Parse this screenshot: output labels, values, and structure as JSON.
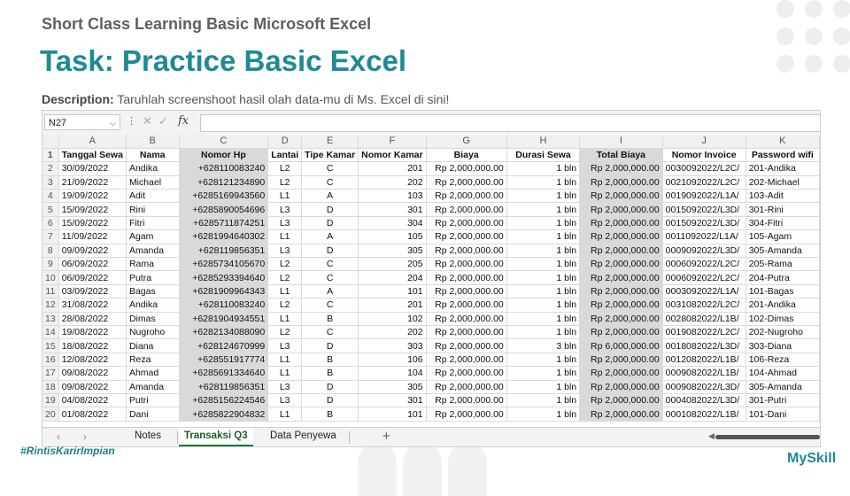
{
  "slide": {
    "subtitle": "Short Class Learning Basic Microsoft Excel",
    "title": "Task: Practice Basic Excel",
    "desc_label": "Description:",
    "desc_text": " Taruhlah screenshoot hasil olah data-mu di Ms. Excel di sini!",
    "hashtag": "#RintisKarirImpian",
    "logo": "MySkill"
  },
  "excel": {
    "name_box": "N27",
    "fx_label": "fx",
    "columns": [
      "A",
      "B",
      "C",
      "D",
      "E",
      "F",
      "G",
      "H",
      "I",
      "J",
      "K"
    ],
    "headers": [
      "Tanggal Sewa",
      "Nama",
      "Nomor Hp",
      "Lantai",
      "Tipe Kamar",
      "Nomor Kamar",
      "Biaya",
      "Durasi Sewa",
      "Total Biaya",
      "Nomor Invoice",
      "Password wifi"
    ],
    "rows": [
      [
        "30/09/2022",
        "Andika",
        "+628110083240",
        "L2",
        "C",
        "201",
        "Rp 2,000,000.00",
        "1 bln",
        "Rp  2,000,000.00",
        "0030092022/L2C/",
        "201-Andika"
      ],
      [
        "21/09/2022",
        "Michael",
        "+62812123489 0",
        "L2",
        "C",
        "202",
        "Rp 2,000,000.00",
        "1 bln",
        "Rp  2,000,000.00",
        "0021092022/L2C/",
        "202-Michael"
      ],
      [
        "19/09/2022",
        "Adit",
        "+6285169943560",
        "L1",
        "A",
        "103",
        "Rp 2,000,000.00",
        "1 bln",
        "Rp  2,000,000.00",
        "0019092022/L1A/",
        "103-Adit"
      ],
      [
        "15/09/2022",
        "Rini",
        "+6285890054696",
        "L3",
        "D",
        "301",
        "Rp 2,000,000.00",
        "1 bln",
        "Rp  2,000,000.00",
        "0015092022/L3D/",
        "301-Rini"
      ],
      [
        "15/09/2022",
        "Fitri",
        "+6285711874251",
        "L3",
        "D",
        "304",
        "Rp 2,000,000.00",
        "1 bln",
        "Rp  2,000,000.00",
        "0015092022/L3D/",
        "304-Fitri"
      ],
      [
        "11/09/2022",
        "Agam",
        "+6281994640302",
        "L1",
        "A",
        "105",
        "Rp 2,000,000.00",
        "1 bln",
        "Rp  2,000,000.00",
        "0011092022/L1A/",
        "105-Agam"
      ],
      [
        "09/09/2022",
        "Amanda",
        "+628119856351",
        "L3",
        "D",
        "305",
        "Rp 2,000,000.00",
        "1 bln",
        "Rp  2,000,000.00",
        "0009092022/L3D/",
        "305-Amanda"
      ],
      [
        "06/09/2022",
        "Rama",
        "+6285734105670",
        "L2",
        "C",
        "205",
        "Rp 2,000,000.00",
        "1 bln",
        "Rp  2,000,000.00",
        "0006092022/L2C/",
        "205-Rama"
      ],
      [
        "06/09/2022",
        "Putra",
        "+6285293394640",
        "L2",
        "C",
        "204",
        "Rp 2,000,000.00",
        "1 bln",
        "Rp  2,000,000.00",
        "0006092022/L2C/",
        "204-Putra"
      ],
      [
        "03/09/2022",
        "Bagas",
        "+6281909964343",
        "L1",
        "A",
        "101",
        "Rp 2,000,000.00",
        "1 bln",
        "Rp  2,000,000.00",
        "0003092022/L1A/",
        "101-Bagas"
      ],
      [
        "31/08/2022",
        "Andika",
        "+628110083240",
        "L2",
        "C",
        "201",
        "Rp 2,000,000.00",
        "1 bln",
        "Rp  2,000,000.00",
        "0031082022/L2C/",
        "201-Andika"
      ],
      [
        "28/08/2022",
        "Dimas",
        "+6281904934551",
        "L1",
        "B",
        "102",
        "Rp 2,000,000.00",
        "1 bln",
        "Rp  2,000,000.00",
        "0028082022/L1B/",
        "102-Dimas"
      ],
      [
        "19/08/2022",
        "Nugroho",
        "+6282134088090",
        "L2",
        "C",
        "202",
        "Rp 2,000,000.00",
        "1 bln",
        "Rp  2,000,000.00",
        "0019082022/L2C/",
        "202-Nugroho"
      ],
      [
        "18/08/2022",
        "Diana",
        "+628124670999",
        "L3",
        "D",
        "303",
        "Rp 2,000,000.00",
        "3 bln",
        "Rp  6,000,000.00",
        "0018082022/L3D/",
        "303-Diana"
      ],
      [
        "12/08/2022",
        "Reza",
        "+628551917774",
        "L1",
        "B",
        "106",
        "Rp 2,000,000.00",
        "1 bln",
        "Rp  2,000,000.00",
        "0012082022/L1B/",
        "106-Reza"
      ],
      [
        "09/08/2022",
        "Ahmad",
        "+6285691334640",
        "L1",
        "B",
        "104",
        "Rp 2,000,000.00",
        "1 bln",
        "Rp  2,000,000.00",
        "0009082022/L1B/",
        "104-Ahmad"
      ],
      [
        "09/08/2022",
        "Amanda",
        "+628119856351",
        "L3",
        "D",
        "305",
        "Rp 2,000,000.00",
        "1 bln",
        "Rp  2,000,000.00",
        "0009082022/L3D/",
        "305-Amanda"
      ],
      [
        "04/08/2022",
        "Putri",
        "+6285156224546",
        "L3",
        "D",
        "301",
        "Rp 2,000,000.00",
        "1 bln",
        "Rp  2,000,000.00",
        "0004082022/L3D/",
        "301-Putri"
      ],
      [
        "01/08/2022",
        "Dani",
        "+6285822904832",
        "L1",
        "B",
        "101",
        "Rp 2,000,000.00",
        "1 bln",
        "Rp  2,000,000.00",
        "0001082022/L1B/",
        "101-Dani"
      ]
    ],
    "tabs": [
      "Notes",
      "Transaksi Q3",
      "Data Penyewa"
    ],
    "active_tab": "Transaksi Q3"
  }
}
